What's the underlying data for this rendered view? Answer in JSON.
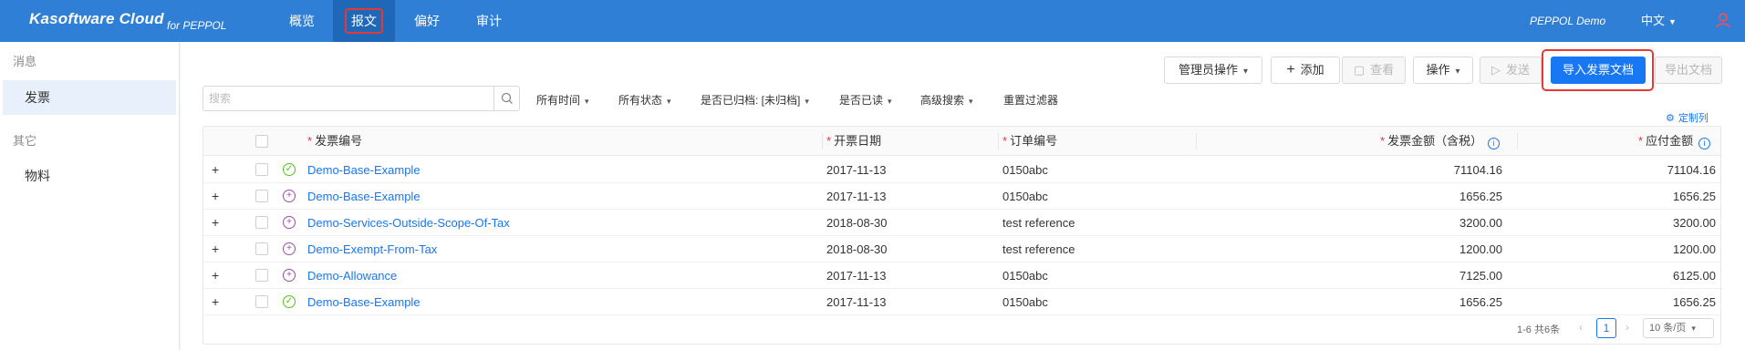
{
  "header": {
    "brand": "Kasoftware Cloud",
    "brand_sub": "for PEPPOL",
    "nav": [
      "概览",
      "报文",
      "偏好",
      "审计"
    ],
    "tenant": "PEPPOL Demo",
    "language": "中文",
    "user_icon": "user-icon",
    "colors": {
      "bar": "#2f7fd6",
      "active_tab": "#1f68b8",
      "highlight": "#e53935"
    }
  },
  "sidebar": {
    "group1": "消息",
    "item1": "发票",
    "group2": "其它",
    "item2": "物料"
  },
  "toolbar": {
    "admin_ops": "管理员操作",
    "add": "添加",
    "view": "查看",
    "operations": "操作",
    "send": "发送",
    "import": "导入发票文档",
    "export": "导出文档"
  },
  "filters": {
    "search_placeholder": "搜索",
    "time": "所有时间",
    "status": "所有状态",
    "archived": "是否已归档: [未归档]",
    "read": "是否已读",
    "advanced": "高级搜索",
    "reset": "重置过滤器",
    "custom_columns": "定制列"
  },
  "table": {
    "headers": {
      "invoice_no": "发票编号",
      "issue_date": "开票日期",
      "order_no": "订单编号",
      "amount": "发票金额（含税）",
      "payable": "应付金额"
    },
    "rows": [
      {
        "status": "success",
        "invoice_no": "Demo-Base-Example",
        "issue_date": "2017-11-13",
        "order_no": "0150abc",
        "amount": "71104.16",
        "payable": "71104.16"
      },
      {
        "status": "pending",
        "invoice_no": "Demo-Base-Example",
        "issue_date": "2017-11-13",
        "order_no": "0150abc",
        "amount": "1656.25",
        "payable": "1656.25"
      },
      {
        "status": "pending",
        "invoice_no": "Demo-Services-Outside-Scope-Of-Tax",
        "issue_date": "2018-08-30",
        "order_no": "test reference",
        "amount": "3200.00",
        "payable": "3200.00"
      },
      {
        "status": "pending",
        "invoice_no": "Demo-Exempt-From-Tax",
        "issue_date": "2018-08-30",
        "order_no": "test reference",
        "amount": "1200.00",
        "payable": "1200.00"
      },
      {
        "status": "pending",
        "invoice_no": "Demo-Allowance",
        "issue_date": "2017-11-13",
        "order_no": "0150abc",
        "amount": "7125.00",
        "payable": "6125.00"
      },
      {
        "status": "success",
        "invoice_no": "Demo-Base-Example",
        "issue_date": "2017-11-13",
        "order_no": "0150abc",
        "amount": "1656.25",
        "payable": "1656.25"
      }
    ]
  },
  "pagination": {
    "info": "1-6 共6条",
    "current": "1",
    "page_size": "10 条/页"
  }
}
